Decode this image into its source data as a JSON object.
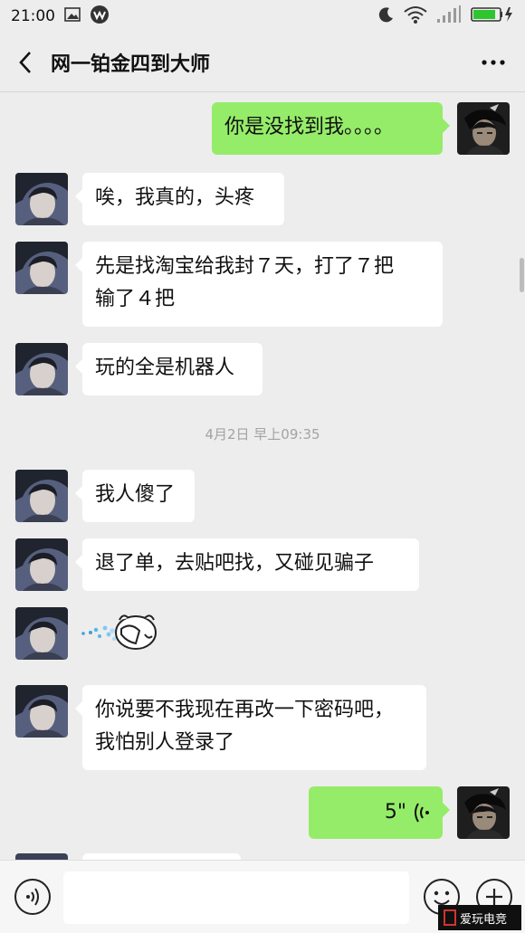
{
  "status_bar": {
    "time": "21:00"
  },
  "header": {
    "title": "网一铂金四到大师"
  },
  "messages": [
    {
      "text": "你是没找到我。。。。"
    },
    {
      "text": "唉，我真的，头疼"
    },
    {
      "line1": "先是找淘宝给我封７天，打了７把",
      "line2": "输了４把"
    },
    {
      "text": "玩的全是机器人"
    },
    {
      "text": "我人傻了"
    },
    {
      "text": "退了单，去贴吧找，又碰见骗子"
    },
    {
      "sticker": "face-palm-sticker"
    },
    {
      "line1": "你说要不我现在再改一下密码吧，",
      "line2": "我怕别人登录了"
    },
    {
      "voice_duration": "5\""
    }
  ],
  "timestamp": "4月2日 早上09:35",
  "input": {
    "placeholder": ""
  },
  "watermark": {
    "text": "爱玩电竞"
  },
  "colors": {
    "outgoing_bubble": "#95ec69",
    "incoming_bubble": "#ffffff",
    "background": "#ededed"
  }
}
